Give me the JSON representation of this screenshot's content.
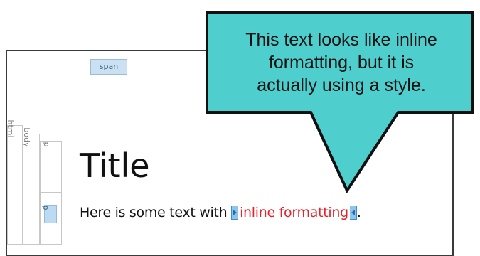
{
  "editor": {
    "span_tag": "span",
    "structure_tags": [
      "html",
      "body",
      "p",
      "p"
    ]
  },
  "document": {
    "title": "Title",
    "line_prefix": "Here is some text with ",
    "inline_text": "inline formatting",
    "line_suffix": "."
  },
  "callout": {
    "lines": [
      "This text looks like inline",
      "formatting, but it is",
      "actually using a style."
    ],
    "fill_color": "#4ecfce",
    "text_color": "#111111"
  },
  "colors": {
    "inline_text": "#e5232b",
    "span_marker": "#8fc4ec",
    "tag_badge": "#c9e1f2"
  }
}
